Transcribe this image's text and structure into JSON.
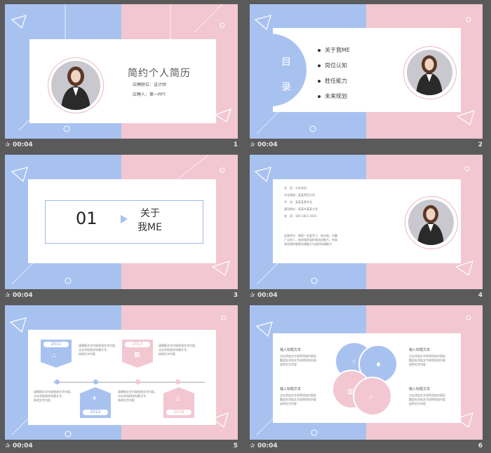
{
  "slides": [
    {
      "title": "简约个人简历",
      "line1": "应聘职位：设计师",
      "line2": "应聘人：第一PPT",
      "time": "00:04",
      "num": "1"
    },
    {
      "mulu": [
        "目",
        "录"
      ],
      "items": [
        "关于我ME",
        "岗位认知",
        "胜任能力",
        "未来规划"
      ],
      "time": "00:04",
      "num": "2"
    },
    {
      "section": "01",
      "heading1": "关于",
      "heading2": "我ME",
      "time": "00:04",
      "num": "3"
    },
    {
      "info": [
        {
          "k": "学　历：",
          "v": "大学本科"
        },
        {
          "k": "毕业院校：",
          "v": "某某师范大学"
        },
        {
          "k": "专　业：",
          "v": "某某某某专业"
        },
        {
          "k": "通讯地址：",
          "v": "某某市某某大学"
        },
        {
          "k": "电　话：",
          "v": "181-1811-1811"
        }
      ],
      "eval": [
        "自我评价：我是一名爱学习、有计划、兴趣",
        "广泛的人，有较强的组织和适应能力，并具",
        "有较强的管理沟通能力与组织协调能力"
      ],
      "time": "00:04",
      "num": "4"
    },
    {
      "years": [
        "2011",
        "2013",
        "2012",
        "2019"
      ],
      "desc": [
        "请替换文字内容修改文字内容，",
        "点击添加相关标题文字，",
        "修改文字内容"
      ],
      "time": "00:04",
      "num": "5"
    },
    {
      "label": "输入标题文本",
      "desc": [
        "点击添加文字说明添加内容标",
        "题此处添加文字说明添加内容",
        "说明文字内容"
      ],
      "time": "00:04",
      "num": "6"
    }
  ],
  "colors": {
    "blue": "#a8c2f0",
    "pink": "#f2c7d2",
    "accent_blue": "#7c9de0",
    "accent_pink": "#e8a9b9"
  }
}
